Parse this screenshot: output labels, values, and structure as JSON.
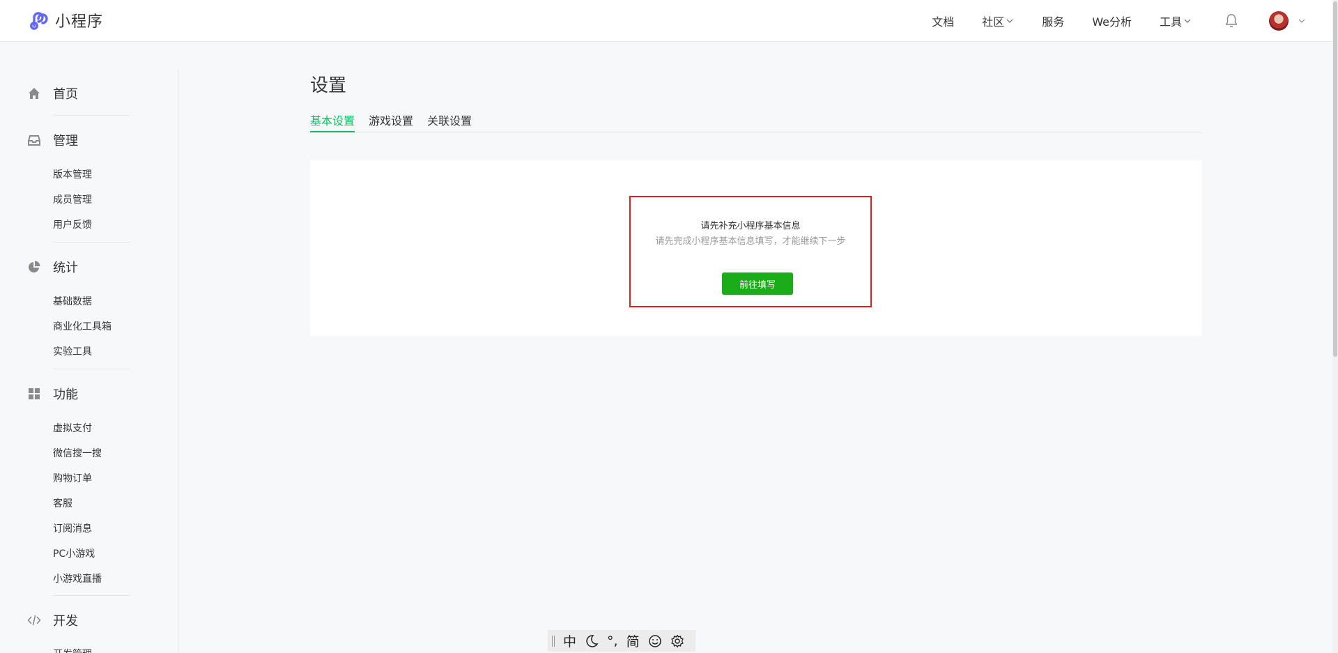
{
  "topbar": {
    "logo_text": "小程序",
    "nav": [
      {
        "label": "文档",
        "has_dropdown": false
      },
      {
        "label": "社区",
        "has_dropdown": true
      },
      {
        "label": "服务",
        "has_dropdown": false
      },
      {
        "label": "We分析",
        "has_dropdown": false
      },
      {
        "label": "工具",
        "has_dropdown": true
      }
    ],
    "icons": [
      "bell-icon",
      "avatar",
      "chevron-down-icon"
    ]
  },
  "sidebar": {
    "home": {
      "label": "首页",
      "icon": "home-icon"
    },
    "manage": {
      "label": "管理",
      "icon": "inbox-icon",
      "items": [
        "版本管理",
        "成员管理",
        "用户反馈"
      ]
    },
    "stats": {
      "label": "统计",
      "icon": "pie-chart-icon",
      "items": [
        "基础数据",
        "商业化工具箱",
        "实验工具"
      ]
    },
    "features": {
      "label": "功能",
      "icon": "grid-icon",
      "items": [
        "虚拟支付",
        "微信搜一搜",
        "购物订单",
        "客服",
        "订阅消息",
        "PC小游戏",
        "小游戏直播"
      ]
    },
    "dev": {
      "label": "开发",
      "icon": "code-icon",
      "items": [
        "开发管理"
      ]
    }
  },
  "main": {
    "title": "设置",
    "tabs": [
      {
        "label": "基本设置",
        "active": true
      },
      {
        "label": "游戏设置",
        "active": false
      },
      {
        "label": "关联设置",
        "active": false
      }
    ],
    "notice": {
      "title": "请先补充小程序基本信息",
      "desc": "请先完成小程序基本信息填写，才能继续下一步",
      "button_label": "前往填写"
    }
  },
  "ime_toolbar": {
    "items": [
      "中",
      "moon-icon",
      "°,",
      "简",
      "smiley-icon",
      "gear-icon"
    ]
  },
  "colors": {
    "accent_green": "#07c160",
    "button_green": "#1aad19",
    "highlight_red": "#e02020"
  }
}
